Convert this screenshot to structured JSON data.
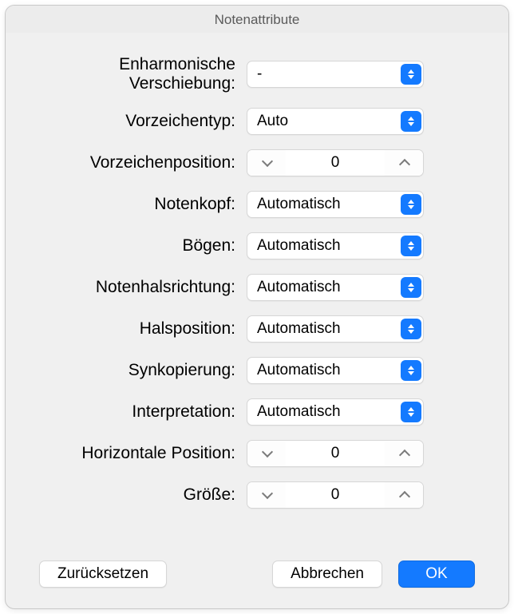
{
  "window": {
    "title": "Notenattribute"
  },
  "rows": {
    "enharmonic": {
      "label": "Enharmonische Verschiebung:",
      "value": "-"
    },
    "accidentType": {
      "label": "Vorzeichentyp:",
      "value": "Auto"
    },
    "accidentPos": {
      "label": "Vorzeichenposition:",
      "value": "0"
    },
    "notehead": {
      "label": "Notenkopf:",
      "value": "Automatisch"
    },
    "slurs": {
      "label": "Bögen:",
      "value": "Automatisch"
    },
    "stemDir": {
      "label": "Notenhalsrichtung:",
      "value": "Automatisch"
    },
    "stemPos": {
      "label": "Halsposition:",
      "value": "Automatisch"
    },
    "syncopation": {
      "label": "Synkopierung:",
      "value": "Automatisch"
    },
    "interp": {
      "label": "Interpretation:",
      "value": "Automatisch"
    },
    "horizPos": {
      "label": "Horizontale Position:",
      "value": "0"
    },
    "size": {
      "label": "Größe:",
      "value": "0"
    }
  },
  "buttons": {
    "reset": "Zurücksetzen",
    "cancel": "Abbrechen",
    "ok": "OK"
  }
}
